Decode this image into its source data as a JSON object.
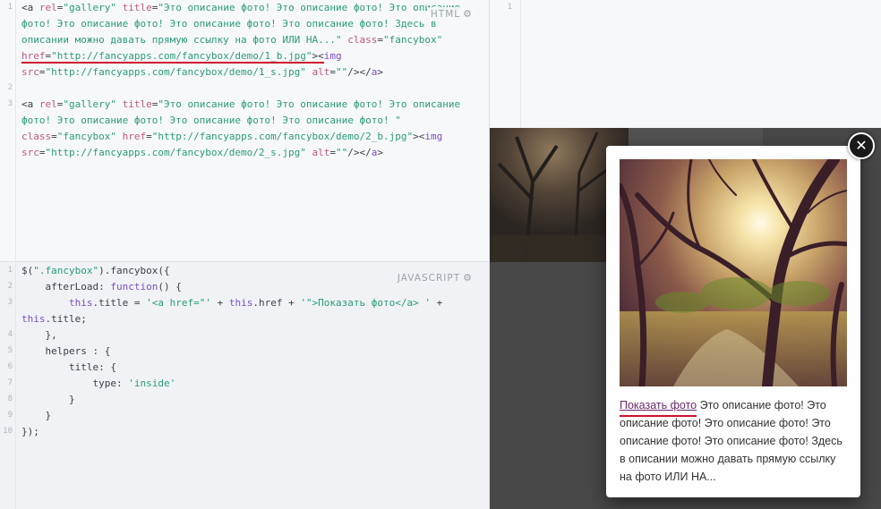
{
  "html_editor": {
    "label": "HTML",
    "gear_icon": "⚙",
    "line_numbers": [
      "1",
      "2",
      "3"
    ],
    "lines": [
      [
        [
          "tag",
          "<a "
        ],
        [
          "attr",
          "rel"
        ],
        [
          "tag",
          "="
        ],
        [
          "str",
          "\"gallery\""
        ],
        [
          "tag",
          " "
        ],
        [
          "attr",
          "title"
        ],
        [
          "tag",
          "="
        ],
        [
          "str",
          "\"Это описание фото! Это описание фото! Это описание"
        ]
      ],
      [
        [
          "str",
          "фото! Это описание фото! Это описание фото! Это описание фото! Здесь в"
        ]
      ],
      [
        [
          "str",
          "описании можно давать прямую ссылку на фото ИЛИ НА...\""
        ],
        [
          "tag",
          " "
        ],
        [
          "attr",
          "class"
        ],
        [
          "tag",
          "="
        ],
        [
          "str",
          "\"fancybox\""
        ]
      ],
      [
        [
          "attr",
          "href"
        ],
        [
          "tag",
          "="
        ],
        [
          "str",
          "\"http://fancyapps.com/fancybox/demo/1_b.jpg\""
        ],
        [
          "tag",
          "><"
        ],
        [
          "kw",
          "img"
        ]
      ],
      [
        [
          "attr",
          "src"
        ],
        [
          "tag",
          "="
        ],
        [
          "str",
          "\"http://fancyapps.com/fancybox/demo/1_s.jpg\""
        ],
        [
          "tag",
          " "
        ],
        [
          "attr",
          "alt"
        ],
        [
          "tag",
          "="
        ],
        [
          "str",
          "\"\""
        ],
        [
          "tag",
          "/></"
        ],
        [
          "kw",
          "a"
        ],
        [
          "tag",
          ">"
        ]
      ],
      [],
      [
        [
          "tag",
          "<a "
        ],
        [
          "attr",
          "rel"
        ],
        [
          "tag",
          "="
        ],
        [
          "str",
          "\"gallery\""
        ],
        [
          "tag",
          " "
        ],
        [
          "attr",
          "title"
        ],
        [
          "tag",
          "="
        ],
        [
          "str",
          "\"Это описание фото! Это описание фото! Это описание"
        ]
      ],
      [
        [
          "str",
          "фото! Это описание фото! Это описание фото! Это описание фото! \""
        ]
      ],
      [
        [
          "attr",
          "class"
        ],
        [
          "tag",
          "="
        ],
        [
          "str",
          "\"fancybox\""
        ],
        [
          "tag",
          " "
        ],
        [
          "attr",
          "href"
        ],
        [
          "tag",
          "="
        ],
        [
          "str",
          "\"http://fancyapps.com/fancybox/demo/2_b.jpg\""
        ],
        [
          "tag",
          "><"
        ],
        [
          "kw",
          "img"
        ]
      ],
      [
        [
          "attr",
          "src"
        ],
        [
          "tag",
          "="
        ],
        [
          "str",
          "\"http://fancyapps.com/fancybox/demo/2_s.jpg\""
        ],
        [
          "tag",
          " "
        ],
        [
          "attr",
          "alt"
        ],
        [
          "tag",
          "="
        ],
        [
          "str",
          "\"\""
        ],
        [
          "tag",
          "/></"
        ],
        [
          "kw",
          "a"
        ],
        [
          "tag",
          ">"
        ]
      ]
    ]
  },
  "js_editor": {
    "label": "JAVASCRIPT",
    "gear_icon": "⚙",
    "line_numbers": [
      "1",
      "2",
      "3",
      "4",
      "5",
      "6",
      "7",
      "8",
      "9",
      "10"
    ],
    "lines": [
      [
        [
          "plain",
          "$("
        ],
        [
          "str",
          "\".fancybox\""
        ],
        [
          "plain",
          ").fancybox({"
        ]
      ],
      [
        [
          "plain",
          "    afterLoad: "
        ],
        [
          "fnk",
          "function"
        ],
        [
          "plain",
          "() {"
        ]
      ],
      [
        [
          "plain",
          "        "
        ],
        [
          "kw",
          "this"
        ],
        [
          "plain",
          ".title = "
        ],
        [
          "str",
          "'<a href=\"'"
        ],
        [
          "plain",
          " + "
        ],
        [
          "kw",
          "this"
        ],
        [
          "plain",
          ".href + "
        ],
        [
          "str",
          "'\">Показать фото</a> '"
        ],
        [
          "plain",
          " +"
        ]
      ],
      [
        [
          "kw",
          "this"
        ],
        [
          "plain",
          ".title;"
        ]
      ],
      [
        [
          "plain",
          "    },"
        ]
      ],
      [
        [
          "plain",
          "    helpers : {"
        ]
      ],
      [
        [
          "plain",
          "        title: {"
        ]
      ],
      [
        [
          "plain",
          "            type: "
        ],
        [
          "str",
          "'inside'"
        ]
      ],
      [
        [
          "plain",
          "        }"
        ]
      ],
      [
        [
          "plain",
          "    }"
        ]
      ],
      [
        [
          "plain",
          "});"
        ]
      ]
    ]
  },
  "css_editor": {
    "line_numbers": [
      "1"
    ]
  },
  "lightbox": {
    "caption_link": "Показать фото",
    "caption_text": " Это описание фото! Это описание фото! Это описание фото! Это описание фото! Это описание фото! Здесь в описании можно давать прямую ссылку на фото ИЛИ НА...",
    "close_icon": "✕"
  },
  "colors": {
    "underline": "#d0102e",
    "string": "#2a9c7a",
    "attribute": "#c2567f",
    "keyword": "#7d4ec4"
  }
}
